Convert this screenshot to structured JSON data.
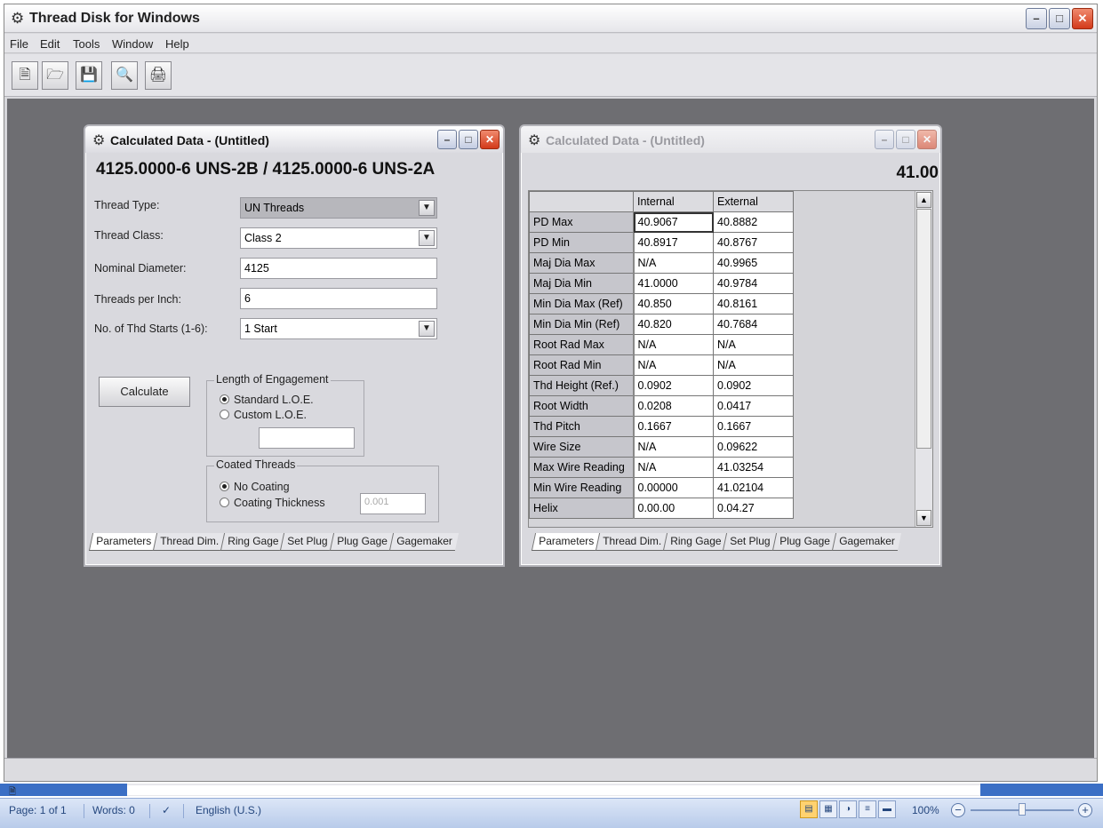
{
  "app": {
    "title": "Thread Disk for Windows",
    "menu": [
      "File",
      "Edit",
      "Tools",
      "Window",
      "Help"
    ],
    "toolbar_icons": [
      "new-document-icon",
      "open-folder-icon",
      "save-disk-icon",
      "print-preview-icon",
      "print-icon"
    ]
  },
  "left_window": {
    "title": "Calculated Data - (Untitled)",
    "headline": "4125.0000-6 UNS-2B  /  4125.0000-6 UNS-2A",
    "fields": {
      "thread_type": {
        "label": "Thread Type:",
        "value": "UN Threads"
      },
      "thread_class": {
        "label": "Thread Class:",
        "value": "Class 2"
      },
      "nominal_diameter": {
        "label": "Nominal Diameter:",
        "value": "4125"
      },
      "threads_per_inch": {
        "label": "Threads per Inch:",
        "value": "6"
      },
      "thread_starts": {
        "label": "No. of Thd Starts (1-6):",
        "value": "1 Start"
      }
    },
    "calculate_label": "Calculate",
    "loe": {
      "title": "Length of Engagement",
      "standard": "Standard L.O.E.",
      "custom": "Custom L.O.E.",
      "custom_value": ""
    },
    "coating": {
      "title": "Coated Threads",
      "none": "No Coating",
      "thickness": "Coating Thickness",
      "thickness_value": "0.001"
    },
    "tabs": [
      "Parameters",
      "Thread Dim.",
      "Ring Gage",
      "Set Plug",
      "Plug Gage",
      "Gagemaker"
    ]
  },
  "right_window": {
    "title": "Calculated Data - (Untitled)",
    "value": "41.00",
    "headers": [
      "",
      "Internal",
      "External"
    ],
    "rows": [
      [
        "PD Max",
        "40.9067",
        "40.8882"
      ],
      [
        "PD Min",
        "40.8917",
        "40.8767"
      ],
      [
        "Maj Dia Max",
        " N/A",
        "40.9965"
      ],
      [
        "Maj Dia Min",
        "41.0000",
        "40.9784"
      ],
      [
        "Min Dia Max (Ref)",
        "40.850",
        "40.8161"
      ],
      [
        "Min Dia Min (Ref)",
        "40.820",
        "40.7684"
      ],
      [
        "Root Rad Max",
        " N/A",
        " N/A"
      ],
      [
        "Root Rad Min",
        " N/A",
        " N/A"
      ],
      [
        "Thd Height (Ref.)",
        "0.0902",
        "0.0902"
      ],
      [
        "Root Width",
        "0.0208",
        "0.0417"
      ],
      [
        "Thd Pitch",
        "0.1667",
        "0.1667"
      ],
      [
        "Wire Size",
        " N/A",
        "0.09622"
      ],
      [
        "Max Wire Reading",
        " N/A",
        "41.03254"
      ],
      [
        "Min Wire Reading",
        "0.00000",
        "41.02104"
      ],
      [
        "Helix",
        "0.00.00",
        " 0.04.27"
      ]
    ],
    "tabs": [
      "Parameters",
      "Thread Dim.",
      "Ring Gage",
      "Set Plug",
      "Plug Gage",
      "Gagemaker"
    ]
  },
  "statusbar": {
    "page": "Page: 1 of 1",
    "words": "Words: 0",
    "language": "English (U.S.)",
    "zoom": "100%"
  }
}
